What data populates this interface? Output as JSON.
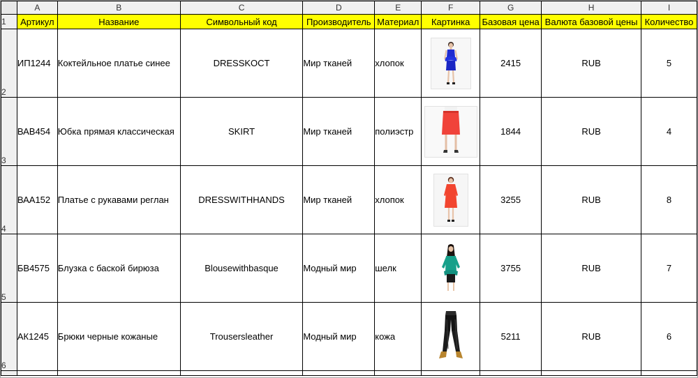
{
  "column_letters": [
    "A",
    "B",
    "C",
    "D",
    "E",
    "F",
    "G",
    "H",
    "I"
  ],
  "row_numbers": [
    "1",
    "2",
    "3",
    "4",
    "5",
    "6"
  ],
  "headers": [
    "Артикул",
    "Название",
    "Символьный код",
    "Производитель",
    "Материал",
    "Картинка",
    "Базовая цена",
    "Валюта базовой цены",
    "Количество"
  ],
  "rows": [
    {
      "article": "ИП1244",
      "name": "Коктейльное платье синее",
      "code": "DRESSKOCT",
      "maker": "Мир тканей",
      "material": "хлопок",
      "picture": "blue-dress-image",
      "price": "2415",
      "currency": "RUB",
      "qty": "5"
    },
    {
      "article": "ВАВ454",
      "name": "Юбка прямая классическая",
      "code": "SKIRT",
      "maker": "Мир тканей",
      "material": "полиэстр",
      "picture": "red-skirt-image",
      "price": "1844",
      "currency": "RUB",
      "qty": "4"
    },
    {
      "article": "ВАА152",
      "name": "Платье с рукавами реглан",
      "code": "DRESSWITHHANDS",
      "maker": "Мир тканей",
      "material": "хлопок",
      "picture": "red-dress-image",
      "price": "3255",
      "currency": "RUB",
      "qty": "8"
    },
    {
      "article": "БВ4575",
      "name": "Блузка с баской бирюза",
      "code": "Blousewithbasque",
      "maker": "Модный мир",
      "material": "шелк",
      "picture": "turquoise-blouse-image",
      "price": "3755",
      "currency": "RUB",
      "qty": "7"
    },
    {
      "article": "АК1245",
      "name": "Брюки черные кожаные",
      "code": "Trousersleather",
      "maker": "Модный мир",
      "material": "кожа",
      "picture": "black-leather-trousers-image",
      "price": "5211",
      "currency": "RUB",
      "qty": "6"
    }
  ],
  "colors": {
    "header_fill": "#ffff00",
    "grid_line": "#000000",
    "heading_bg": "#f0f0f0"
  }
}
